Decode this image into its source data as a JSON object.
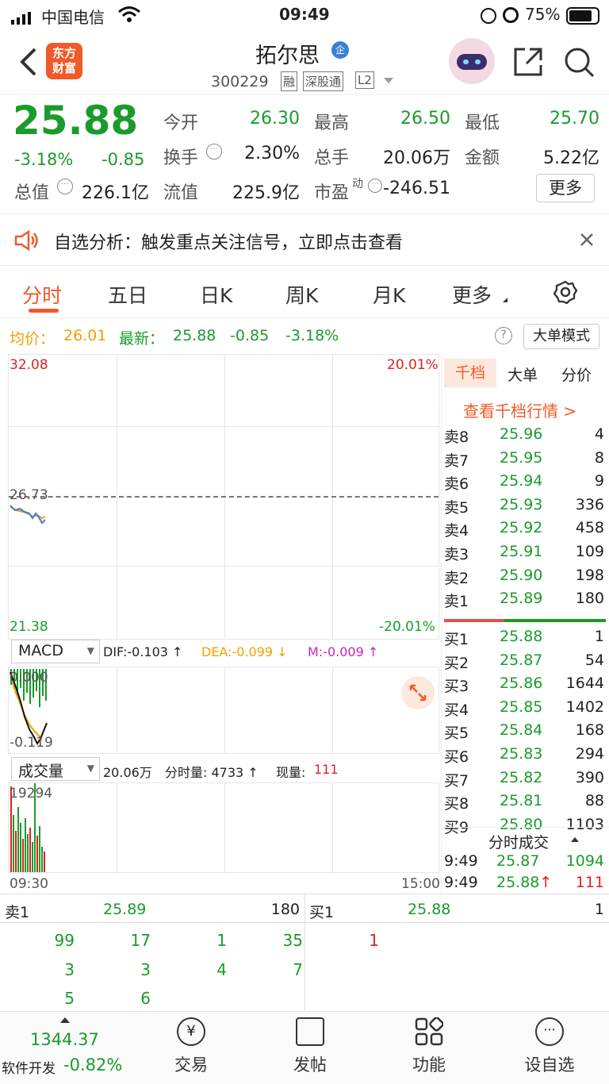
{
  "status_bar": {
    "carrier": "中国电信",
    "time": "09:49",
    "battery": "75%"
  },
  "header": {
    "logo_text": "东方\n财富",
    "stock_name": "拓尔思",
    "enterprise_badge": "企",
    "stock_code": "300229",
    "tags": [
      "融",
      "深股通",
      "L2"
    ]
  },
  "quote": {
    "price": "25.88",
    "change_pct": "-3.18%",
    "change": "-0.85",
    "open_label": "今开",
    "open": "26.30",
    "high_label": "最高",
    "high": "26.50",
    "low_label": "最低",
    "low": "25.70",
    "turnover_label": "换手",
    "turnover": "2.30%",
    "volume_label": "总手",
    "volume": "20.06万",
    "amount_label": "金额",
    "amount": "5.22亿",
    "mktcap_label": "总值",
    "mktcap": "226.1亿",
    "float_label": "流值",
    "float": "225.9亿",
    "pe_label": "市盈",
    "pe_sup": "动",
    "pe": "-246.51",
    "more_button": "更多"
  },
  "banner": {
    "text": "自选分析：触发重点关注信号，立即点击查看"
  },
  "tabs": [
    "分时",
    "五日",
    "日K",
    "周K",
    "月K",
    "更多"
  ],
  "info_line": {
    "avg_label": "均价：",
    "avg": "26.01",
    "latest_label": "最新：",
    "latest": "25.88",
    "change": "-0.85",
    "change_pct": "-3.18%",
    "big_order_button": "大单模式"
  },
  "chart": {
    "top_price": "32.08",
    "top_pct": "20.01%",
    "mid_price": "26.73",
    "bottom_price": "21.38",
    "bottom_pct": "-20.01%",
    "start_time": "09:30",
    "end_time": "15:00"
  },
  "macd": {
    "selector": "MACD",
    "dif": "DIF:-0.103 ↑",
    "dea": "DEA:-0.099 ↓",
    "m": "M:-0.009 ↑",
    "top_value": "0.000",
    "bottom_value": "-0.119"
  },
  "volume_panel": {
    "selector": "成交量",
    "total": "20.06万",
    "bar_vol": "分时量: 4733 ↑",
    "now_label": "现量:",
    "now": "111",
    "max": "19294"
  },
  "orderbook": {
    "tabs": [
      "千档",
      "大单",
      "分价"
    ],
    "link": "查看千档行情 >",
    "asks": [
      {
        "label": "卖8",
        "price": "25.96",
        "vol": "4"
      },
      {
        "label": "卖7",
        "price": "25.95",
        "vol": "8"
      },
      {
        "label": "卖6",
        "price": "25.94",
        "vol": "9"
      },
      {
        "label": "卖5",
        "price": "25.93",
        "vol": "336"
      },
      {
        "label": "卖4",
        "price": "25.92",
        "vol": "458"
      },
      {
        "label": "卖3",
        "price": "25.91",
        "vol": "109"
      },
      {
        "label": "卖2",
        "price": "25.90",
        "vol": "198"
      },
      {
        "label": "卖1",
        "price": "25.89",
        "vol": "180"
      }
    ],
    "bids": [
      {
        "label": "买1",
        "price": "25.88",
        "vol": "1"
      },
      {
        "label": "买2",
        "price": "25.87",
        "vol": "54"
      },
      {
        "label": "买3",
        "price": "25.86",
        "vol": "1644"
      },
      {
        "label": "买4",
        "price": "25.85",
        "vol": "1402"
      },
      {
        "label": "买5",
        "price": "25.84",
        "vol": "168"
      },
      {
        "label": "买6",
        "price": "25.83",
        "vol": "294"
      },
      {
        "label": "买7",
        "price": "25.82",
        "vol": "390"
      },
      {
        "label": "买8",
        "price": "25.81",
        "vol": "88"
      },
      {
        "label": "买9",
        "price": "25.80",
        "vol": "1103"
      }
    ],
    "ticks_header": "分时成交",
    "ticks": [
      {
        "time": "9:49",
        "price": "25.87",
        "vol": "1094"
      },
      {
        "time": "9:49",
        "price": "25.88↑",
        "vol": "111"
      }
    ]
  },
  "queue": {
    "ask_label": "卖1",
    "ask_price": "25.89",
    "ask_vol": "180",
    "bid_label": "买1",
    "bid_price": "25.88",
    "bid_vol": "1",
    "ask_rows": [
      [
        "99",
        "17",
        "1",
        "35"
      ],
      [
        "3",
        "3",
        "4",
        "7"
      ],
      [
        "5",
        "6",
        "",
        ""
      ]
    ],
    "bid_rows": [
      [
        "1"
      ]
    ]
  },
  "bottom_nav": {
    "index_value": "1344.37",
    "index_name": "软件开发",
    "index_change": "-0.82%",
    "items": [
      "交易",
      "发帖",
      "功能",
      "设自选"
    ]
  },
  "colors": {
    "up": "#e02020",
    "down": "#1a9b2b",
    "accent": "#f05a28",
    "avg_line": "#f0a000",
    "price_line": "#3b7fd6"
  }
}
